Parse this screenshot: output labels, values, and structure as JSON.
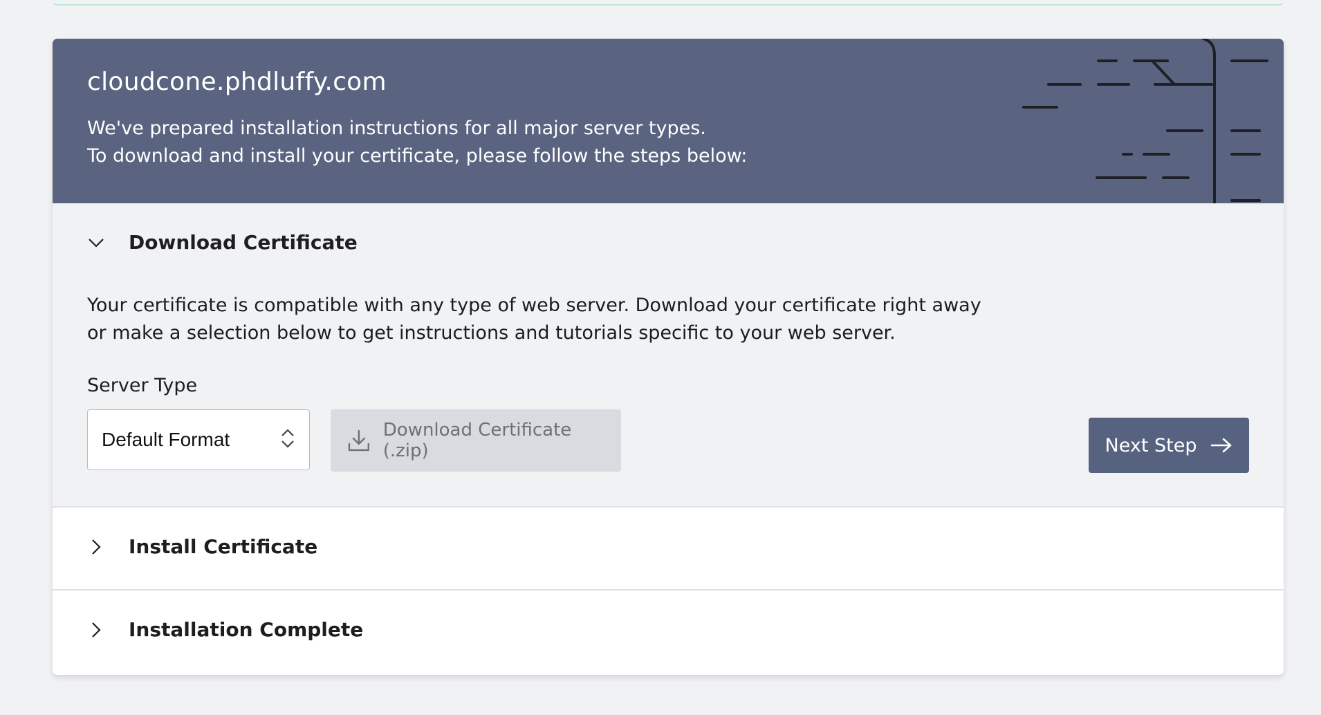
{
  "header": {
    "domain": "cloudcone.phdluffy.com",
    "line1": "We've prepared installation instructions for all major server types.",
    "line2": "To download and install your certificate, please follow the steps below:"
  },
  "steps": [
    {
      "title": "Download Certificate",
      "expanded": true,
      "description": "Your certificate is compatible with any type of web server. Download your certificate right away or make a selection below to get instructions and tutorials specific to your web server.",
      "server_type_label": "Server Type",
      "server_type_value": "Default Format",
      "download_button": "Download Certificate (.zip)",
      "next_button": "Next Step"
    },
    {
      "title": "Install Certificate",
      "expanded": false
    },
    {
      "title": "Installation Complete",
      "expanded": false
    }
  ],
  "icons": {
    "expanded_chevron": "chevron-down-icon",
    "collapsed_chevron": "chevron-right-icon",
    "select": "select-updown-icon",
    "download": "download-icon",
    "next": "arrow-right-icon"
  },
  "colors": {
    "header_bg": "#5a6480",
    "primary_button": "#56627f",
    "disabled_button": "#d8dbe0",
    "page_bg": "#f1f2f4"
  }
}
